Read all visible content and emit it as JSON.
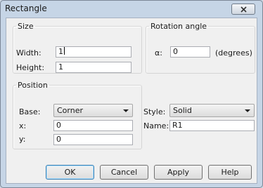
{
  "window": {
    "title": "Rectangle",
    "close_icon": "close-icon"
  },
  "size": {
    "legend": "Size",
    "width_label": "Width:",
    "width_value": "1",
    "height_label": "Height:",
    "height_value": "1"
  },
  "rotation": {
    "legend": "Rotation angle",
    "alpha_label": "α:",
    "alpha_value": "0",
    "unit": "(degrees)"
  },
  "position": {
    "legend": "Position",
    "base_label": "Base:",
    "base_value": "Corner",
    "x_label": "x:",
    "x_value": "0",
    "y_label": "y:",
    "y_value": "0"
  },
  "style": {
    "label": "Style:",
    "value": "Solid"
  },
  "name": {
    "label": "Name:",
    "value": "R1"
  },
  "buttons": {
    "ok": "OK",
    "cancel": "Cancel",
    "apply": "Apply",
    "help": "Help"
  }
}
